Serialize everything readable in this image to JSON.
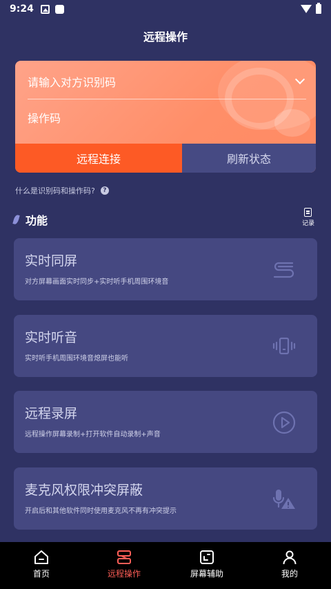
{
  "status_bar": {
    "time": "9:24"
  },
  "header": {
    "title": "远程操作"
  },
  "connect": {
    "id_placeholder": "请输入对方识别码",
    "code_placeholder": "操作码",
    "connect_label": "远程连接",
    "refresh_label": "刷新状态"
  },
  "help": {
    "text": "什么是识别码和操作码?"
  },
  "section": {
    "title": "功能",
    "records_label": "记录"
  },
  "features": [
    {
      "title": "实时同屏",
      "desc": "对方屏幕画面实时同步+实时听手机周围环境音",
      "icon": "sync-icon"
    },
    {
      "title": "实时听音",
      "desc": "实时听手机周围环境音熄屏也能听",
      "icon": "phone-vibrate-icon"
    },
    {
      "title": "远程录屏",
      "desc": "远程操作屏幕录制+打开软件自动录制+声音",
      "icon": "play-icon"
    },
    {
      "title": "麦克风权限冲突屏蔽",
      "desc": "开启后和其他软件同时使用麦克风不再有冲突提示",
      "icon": "mic-warning-icon"
    }
  ],
  "tabs": [
    {
      "label": "首页",
      "icon": "home-icon",
      "active": false
    },
    {
      "label": "远程操作",
      "icon": "remote-icon",
      "active": true
    },
    {
      "label": "屏幕辅助",
      "icon": "screen-assist-icon",
      "active": false
    },
    {
      "label": "我的",
      "icon": "profile-icon",
      "active": false
    }
  ],
  "colors": {
    "background": "#2f3263",
    "card": "#454881",
    "accent": "#fd5a25",
    "active_tab": "#ff5e57"
  }
}
